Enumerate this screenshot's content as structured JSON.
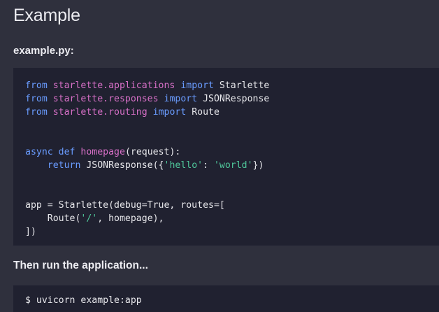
{
  "heading": "Example",
  "file_label": "example.py:",
  "code": {
    "lines": [
      [
        {
          "t": "from ",
          "c": "kw"
        },
        {
          "t": "starlette.applications",
          "c": "mod"
        },
        {
          "t": " import ",
          "c": "kw"
        },
        {
          "t": "Starlette",
          "c": ""
        }
      ],
      [
        {
          "t": "from ",
          "c": "kw"
        },
        {
          "t": "starlette.responses",
          "c": "mod"
        },
        {
          "t": " import ",
          "c": "kw"
        },
        {
          "t": "JSONResponse",
          "c": ""
        }
      ],
      [
        {
          "t": "from ",
          "c": "kw"
        },
        {
          "t": "starlette.routing",
          "c": "mod"
        },
        {
          "t": " import ",
          "c": "kw"
        },
        {
          "t": "Route",
          "c": ""
        }
      ],
      [],
      [],
      [
        {
          "t": "async def ",
          "c": "kw"
        },
        {
          "t": "homepage",
          "c": "fn"
        },
        {
          "t": "(request):",
          "c": ""
        }
      ],
      [
        {
          "t": "    return ",
          "c": "kw"
        },
        {
          "t": "JSONResponse({",
          "c": ""
        },
        {
          "t": "'hello'",
          "c": "str"
        },
        {
          "t": ": ",
          "c": ""
        },
        {
          "t": "'world'",
          "c": "str"
        },
        {
          "t": "})",
          "c": ""
        }
      ],
      [],
      [],
      [
        {
          "t": "app = Starlette(debug=True, routes=[",
          "c": ""
        }
      ],
      [
        {
          "t": "    Route(",
          "c": ""
        },
        {
          "t": "'/'",
          "c": "str"
        },
        {
          "t": ", homepage),",
          "c": ""
        }
      ],
      [
        {
          "t": "])",
          "c": ""
        }
      ]
    ]
  },
  "run_text": "Then run the application...",
  "shell_command": "$ uvicorn example:app",
  "colors": {
    "background": "#2f303d",
    "code_background": "#202130",
    "keyword": "#6a9cff",
    "module": "#d770c7",
    "string": "#4fc79b"
  }
}
